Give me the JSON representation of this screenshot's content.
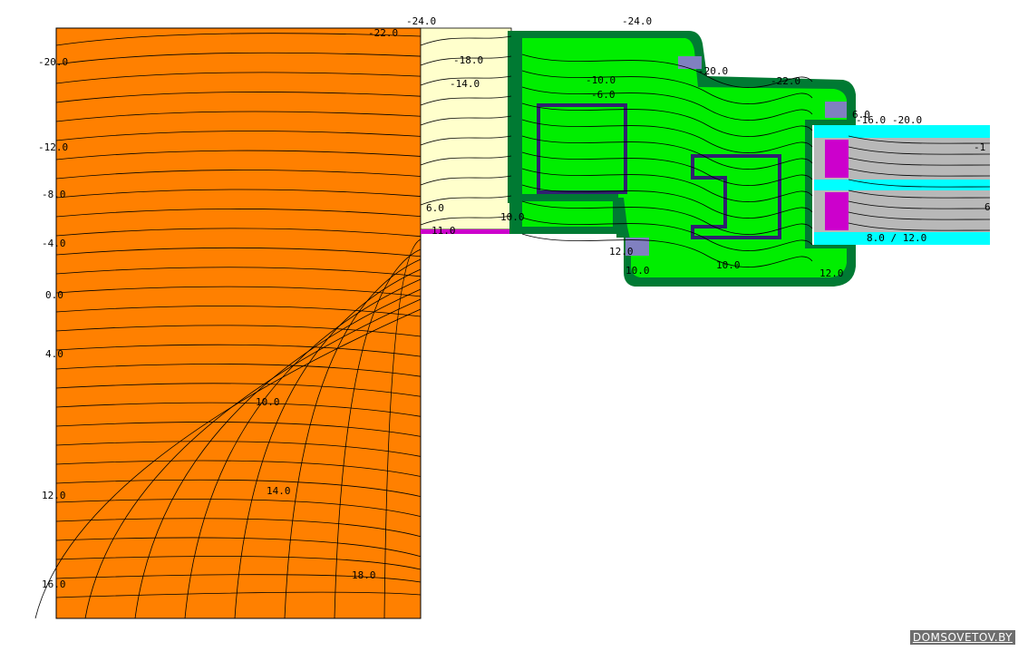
{
  "colors": {
    "wall": "#ff8000",
    "insulation": "#ffffcc",
    "pvc": "#00ee00",
    "pvc_dark": "#007a33",
    "steel": "#302070",
    "glass": "#00ffff",
    "spacer": "#b8b8b8",
    "seal": "#cc00cc",
    "gasket": "#8080c0",
    "isoline": "#000000"
  },
  "isotherm_labels": [
    {
      "id": "n24a",
      "text": "-24.0"
    },
    {
      "id": "n24b",
      "text": "-24.0"
    },
    {
      "id": "n22a",
      "text": "-22.0"
    },
    {
      "id": "n20a",
      "text": "-20.0"
    },
    {
      "id": "n18a",
      "text": "-18.0"
    },
    {
      "id": "n14a",
      "text": "-14.0"
    },
    {
      "id": "n12a",
      "text": "-12.0"
    },
    {
      "id": "n10a",
      "text": "-10.0"
    },
    {
      "id": "n8a",
      "text": "-8.0"
    },
    {
      "id": "n6a",
      "text": "-6.0"
    },
    {
      "id": "n4a",
      "text": "-4.0"
    },
    {
      "id": "z0",
      "text": "0.0"
    },
    {
      "id": "p4",
      "text": "4.0"
    },
    {
      "id": "p10",
      "text": "10.0"
    },
    {
      "id": "p12",
      "text": "12.0"
    },
    {
      "id": "p14",
      "text": "14.0"
    },
    {
      "id": "p16",
      "text": "16.0"
    },
    {
      "id": "p18",
      "text": "18.0"
    },
    {
      "id": "n20b",
      "text": "-20.0"
    },
    {
      "id": "n22b",
      "text": "-22.0"
    },
    {
      "id": "n16b",
      "text": "-16.0"
    },
    {
      "id": "n20c",
      "text": "-20.0"
    },
    {
      "id": "p6",
      "text": "6.0"
    },
    {
      "id": "p10b",
      "text": "10.0"
    },
    {
      "id": "p11",
      "text": "11.0"
    },
    {
      "id": "p12b",
      "text": "12.0"
    },
    {
      "id": "p10c",
      "text": "10.0"
    },
    {
      "id": "p10d",
      "text": "10.0"
    },
    {
      "id": "p12c",
      "text": "12.0"
    },
    {
      "id": "p8_12",
      "text": "8.0 / 12.0"
    },
    {
      "id": "p6b",
      "text": "6.0"
    },
    {
      "id": "p6c",
      "text": "6"
    },
    {
      "id": "n1",
      "text": "-1"
    }
  ],
  "watermark": "DOMSOVETOV.BY"
}
